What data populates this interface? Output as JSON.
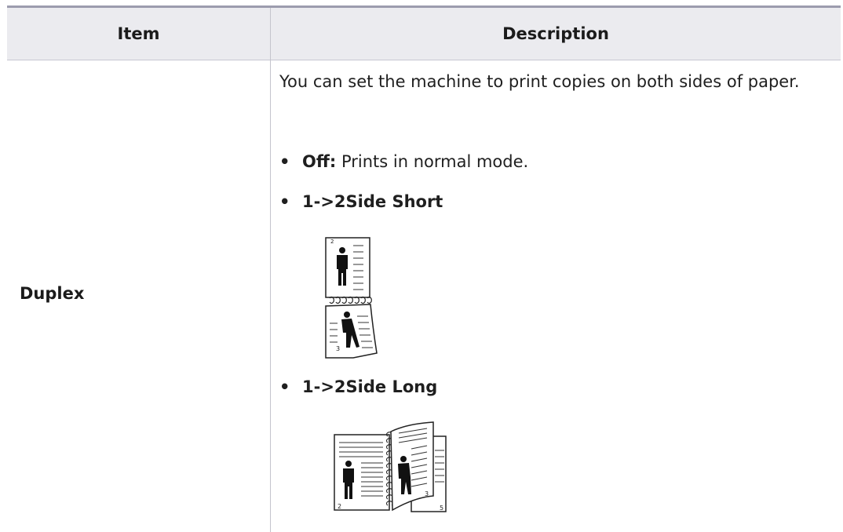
{
  "table": {
    "headers": {
      "item": "Item",
      "description": "Description"
    },
    "rows": [
      {
        "item": "Duplex",
        "intro": "You can set the machine to print copies on both sides of paper.",
        "options": [
          {
            "label": "Off:",
            "text": "Prints in normal mode."
          },
          {
            "label": "1->2Side Short",
            "text": ""
          },
          {
            "label": "1->2Side Long",
            "text": ""
          }
        ],
        "illustrations": {
          "short": {
            "top_page": "2",
            "bottom_page": "3"
          },
          "long": {
            "left_page": "2",
            "right_inner": "3",
            "right_outer": "5"
          }
        }
      }
    ]
  }
}
